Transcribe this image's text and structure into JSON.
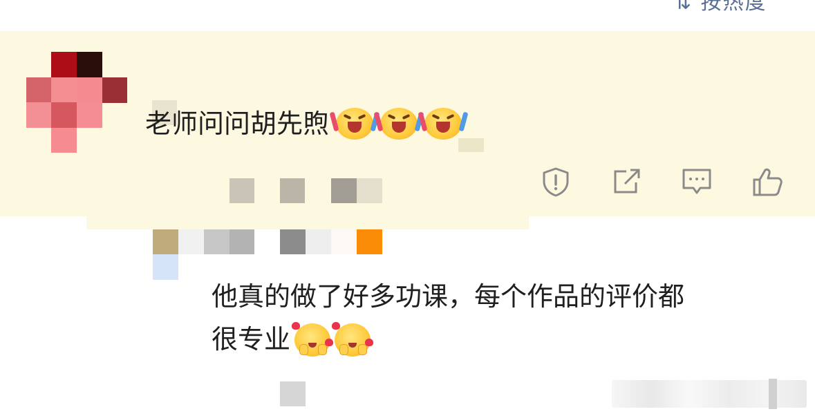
{
  "header": {
    "sort_label": "⇅ 按热度"
  },
  "comments": [
    {
      "text": "老师问问胡先煦",
      "emoji": [
        "laugh-cry-cheer",
        "laugh-cry-cheer",
        "laugh-cry-cheer"
      ],
      "highlighted": true,
      "actions": [
        {
          "name": "report-icon"
        },
        {
          "name": "share-icon"
        },
        {
          "name": "comment-icon"
        },
        {
          "name": "like-icon"
        }
      ]
    },
    {
      "text_line1": "他真的做了好多功课，每个作品的评价都",
      "text_line2": "很专业",
      "emoji": [
        "heart-blush-face",
        "heart-blush-face"
      ],
      "is_reply": true
    }
  ],
  "colors": {
    "highlight_bg": "#fdf8e0",
    "icon_gray": "#8a8a8a",
    "link_blue": "#5b6f95",
    "text": "#1f1f1f"
  }
}
